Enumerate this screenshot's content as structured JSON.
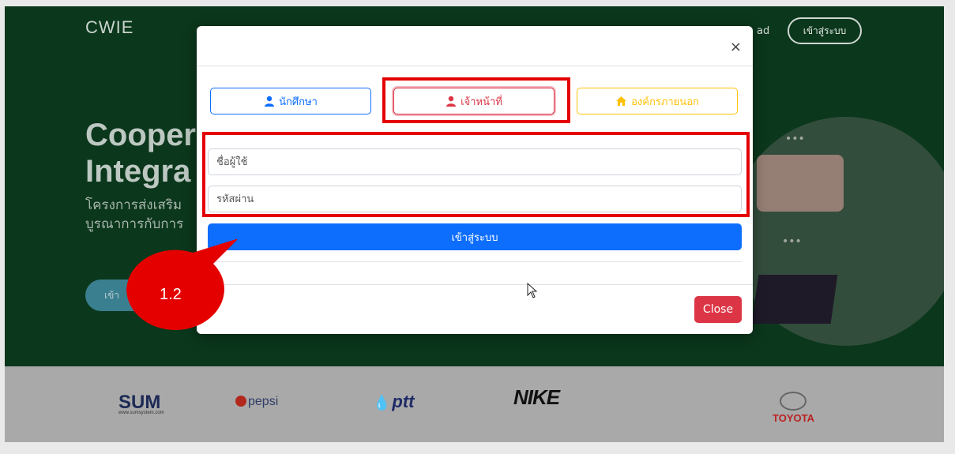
{
  "site": {
    "brand": "CWIE",
    "nav_download": "ad",
    "nav_login": "เข้าสู่ระบบ",
    "hero_title_line1": "Cooper",
    "hero_title_line2": "Integra",
    "hero_sub_line1": "โครงการส่งเสริม",
    "hero_sub_line2": "บูรณาการกับการ",
    "hero_button": "เข้า",
    "illus_dots": "•••"
  },
  "partners": {
    "sum": "SUM",
    "sum_url": "www.sumsystem.com",
    "pepsi": "pepsi",
    "ptt": "ptt",
    "nike": "NIKE",
    "toyota": "TOYOTA"
  },
  "modal": {
    "close_symbol": "×",
    "tabs": [
      {
        "label": "นักศึกษา",
        "icon": "user-icon",
        "color": "#0d6efd"
      },
      {
        "label": "เจ้าหน้าที่",
        "icon": "user-icon",
        "color": "#dc3545"
      },
      {
        "label": "องค์กรภายนอก",
        "icon": "home-icon",
        "color": "#ffc107"
      }
    ],
    "username_placeholder": "ชื่อผู้ใช้",
    "password_placeholder": "รหัสผ่าน",
    "submit_label": "เข้าสู่ระบบ",
    "close_label": "Close"
  },
  "annotation": {
    "callout_label": "1.2",
    "highlight_color": "#e50000"
  }
}
